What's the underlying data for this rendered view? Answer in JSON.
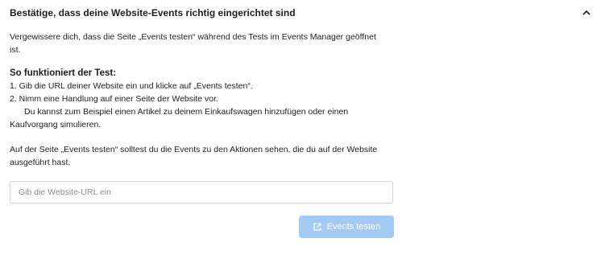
{
  "panel": {
    "title": "Bestätige, dass deine Website-Events richtig eingerichtet sind"
  },
  "intro": {
    "text": "Vergewissere dich, dass die Seite „Events testen“ während des Tests im Events Manager geöffnet ist."
  },
  "howto": {
    "title": "So funktioniert der Test:",
    "steps": [
      "1.  Gib die URL deiner Website ein und klicke auf „Events testen“.",
      "2.  Nimm eine Handlung auf einer Seite der Website vor."
    ],
    "step2_detail": "Du kannst zum Beispiel einen Artikel zu deinem Einkaufswagen hinzufügen oder einen Kaufvorgang simulieren."
  },
  "outro": {
    "text": "Auf der Seite „Events testen“ solltest du die Events zu den Aktionen sehen, die du auf der Website ausgeführt hast."
  },
  "url_input": {
    "placeholder": "Gib die Website-URL ein",
    "value": ""
  },
  "test_button": {
    "label": "Events testen",
    "icon": "external-link-icon",
    "disabled": true
  },
  "colors": {
    "button_disabled_bg": "#a4c9f3",
    "text": "#1c1e21",
    "placeholder": "#8a8d91",
    "input_border": "#cfd3d8"
  },
  "icons": {
    "collapse": "chevron-up-icon"
  }
}
